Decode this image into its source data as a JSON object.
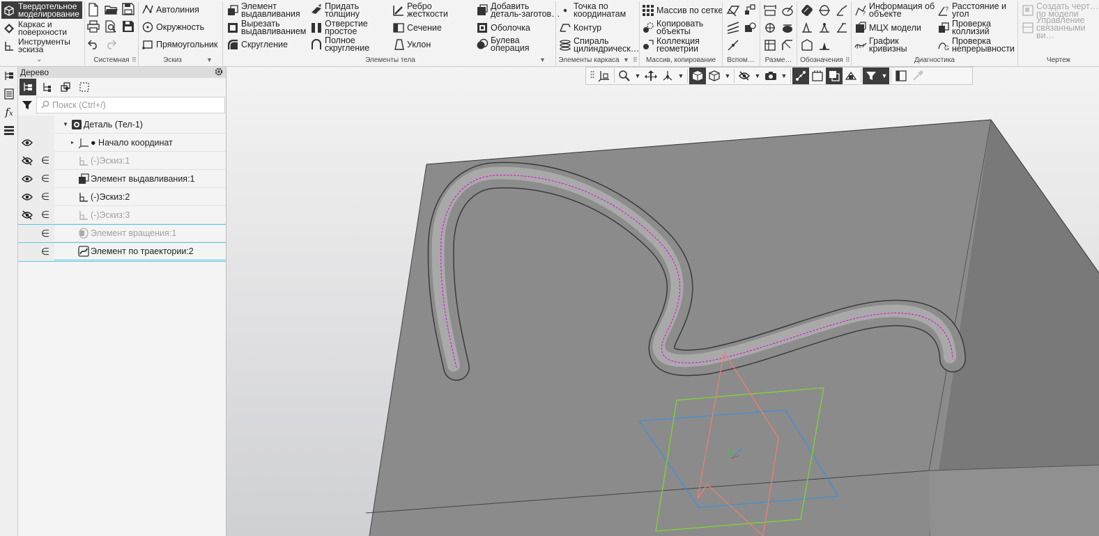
{
  "ribbon": {
    "modes": [
      {
        "label": "Твердотельное\nмоделирование",
        "active": true
      },
      {
        "label": "Каркас и\nповерхности",
        "active": false
      },
      {
        "label": "Инструменты\nэскиза",
        "active": false
      }
    ],
    "sketch": {
      "autoline": "Автолиния",
      "circle": "Окружность",
      "rectangle": "Прямоугольник"
    },
    "body": {
      "extrude": "Элемент\nвыдавливания",
      "cut_extrude": "Вырезать\nвыдавливанием",
      "fillet": "Скругление",
      "thicken": "Придать\nтолщину",
      "simple_hole": "Отверстие\nпростое",
      "full_round": "Полное\nскругление",
      "rib": "Ребро\nжесткости",
      "section": "Сечение",
      "draft": "Уклон",
      "add_blank": "Добавить\nдеталь-заготов…",
      "shell": "Оболочка",
      "boolean": "Булева\nоперация"
    },
    "wireframe": {
      "point_coords": "Точка по\nкоординатам",
      "contour": "Контур",
      "helix": "Спираль\nцилиндрическ…"
    },
    "array": {
      "grid_array": "Массив по сетке",
      "copy_objects": "Копировать\nобъекты",
      "geometry_collection": "Коллекция\nгеометрии"
    },
    "diagnostics": {
      "object_info": "Информация об\nобъекте",
      "mass_props": "МЦХ модели",
      "curvature_graph": "График\nкривизны",
      "distance_angle": "Расстояние и\nугол",
      "collision_check": "Проверка\nколлизий",
      "continuity_check": "Проверка\nнепрерывности"
    },
    "drawing": {
      "create_drawing": "Создать черт…\nпо модели",
      "manage_views": "Управление\nсвязанными ви…"
    },
    "groups": {
      "system": "Системная",
      "sketch": "Эскиз",
      "body_elements": "Элементы тела",
      "wireframe_elements": "Элементы каркаса",
      "array_copy": "Массив, копирование",
      "auxiliary": "Вспом…",
      "dimensions": "Разме…",
      "annotations": "Обозначения",
      "diagnostics": "Диагностика",
      "drawing": "Чертеж"
    }
  },
  "tree": {
    "title": "Дерево",
    "search_placeholder": "Поиск (Ctrl+/)",
    "items": [
      {
        "name": "Деталь (Тел-1)"
      },
      {
        "name": "● Начало координат"
      },
      {
        "name": "(-)Эскиз:1"
      },
      {
        "name": "Элемент выдавливания:1"
      },
      {
        "name": "(-)Эскиз:2"
      },
      {
        "name": "(-)Эскиз:3"
      },
      {
        "name": "Элемент вращения:1"
      },
      {
        "name": "Элемент по траектории:2"
      }
    ]
  },
  "colors": {
    "accent_dark": "#3c3c3c",
    "tube_path": "#e100e1",
    "plane_green": "#7ddc2a",
    "plane_blue": "#3a8fe0",
    "plane_red": "#f08070",
    "model_face": "#8a8a8a"
  }
}
